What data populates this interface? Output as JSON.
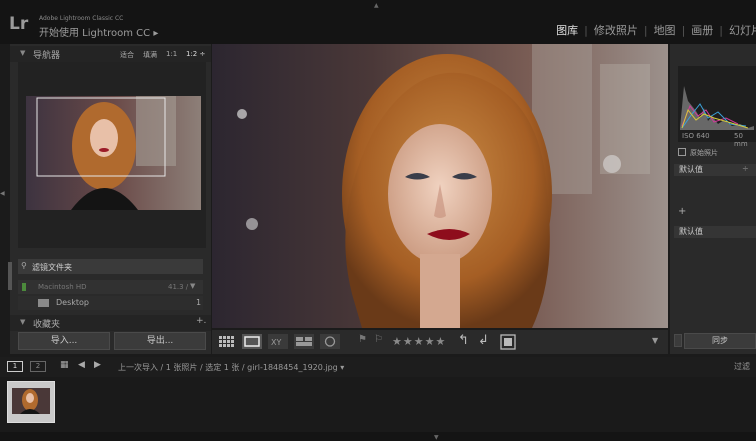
{
  "app": {
    "logo": "Lr",
    "name": "Adobe Lightroom Classic CC",
    "subtitle": "开始使用 Lightroom CC ▸"
  },
  "modules": [
    "图库",
    "修改照片",
    "地图",
    "画册",
    "幻灯片"
  ],
  "navigator": {
    "title": "导航器",
    "zoom_fit": "适合",
    "zoom_fill": "填满",
    "zoom_1": "1:1",
    "zoom_2": "1:2 ÷"
  },
  "filter": {
    "label": "滤镜文件夹"
  },
  "folders": {
    "volume_label": "Macintosh HD",
    "volume_meta": "41.3 / ",
    "item_label": "Desktop",
    "item_count": "1"
  },
  "collections": {
    "title": "收藏夹",
    "plus": "+."
  },
  "buttons": {
    "import": "导入...",
    "export": "导出..."
  },
  "right_panel": {
    "iso": "ISO 640",
    "focal": "50 mm",
    "original": "原始照片",
    "preset": "默认值",
    "plus": "+",
    "preset2": "默认值",
    "sync": "同步"
  },
  "bottom_bar": {
    "page1": "1",
    "page2": "2",
    "breadcrumb": "上一次导入 / 1 张照片 / 选定 1 张 / girl-1848454_1920.jpg ▾",
    "filter": "过滤"
  },
  "toolbar": {
    "stars": "★★★★★"
  },
  "colors": {
    "active_module": "#e0e0e0",
    "panel": "#2a2a2a",
    "toolbar": "#2a2a2a"
  },
  "icons": [
    "grid-view-icon",
    "loupe-view-icon",
    "compare-view-icon",
    "survey-view-icon",
    "people-view-icon",
    "flag-icon",
    "reject-flag-icon",
    "rotate-left-icon",
    "rotate-right-icon",
    "crop-icon",
    "chevron-down-icon"
  ]
}
